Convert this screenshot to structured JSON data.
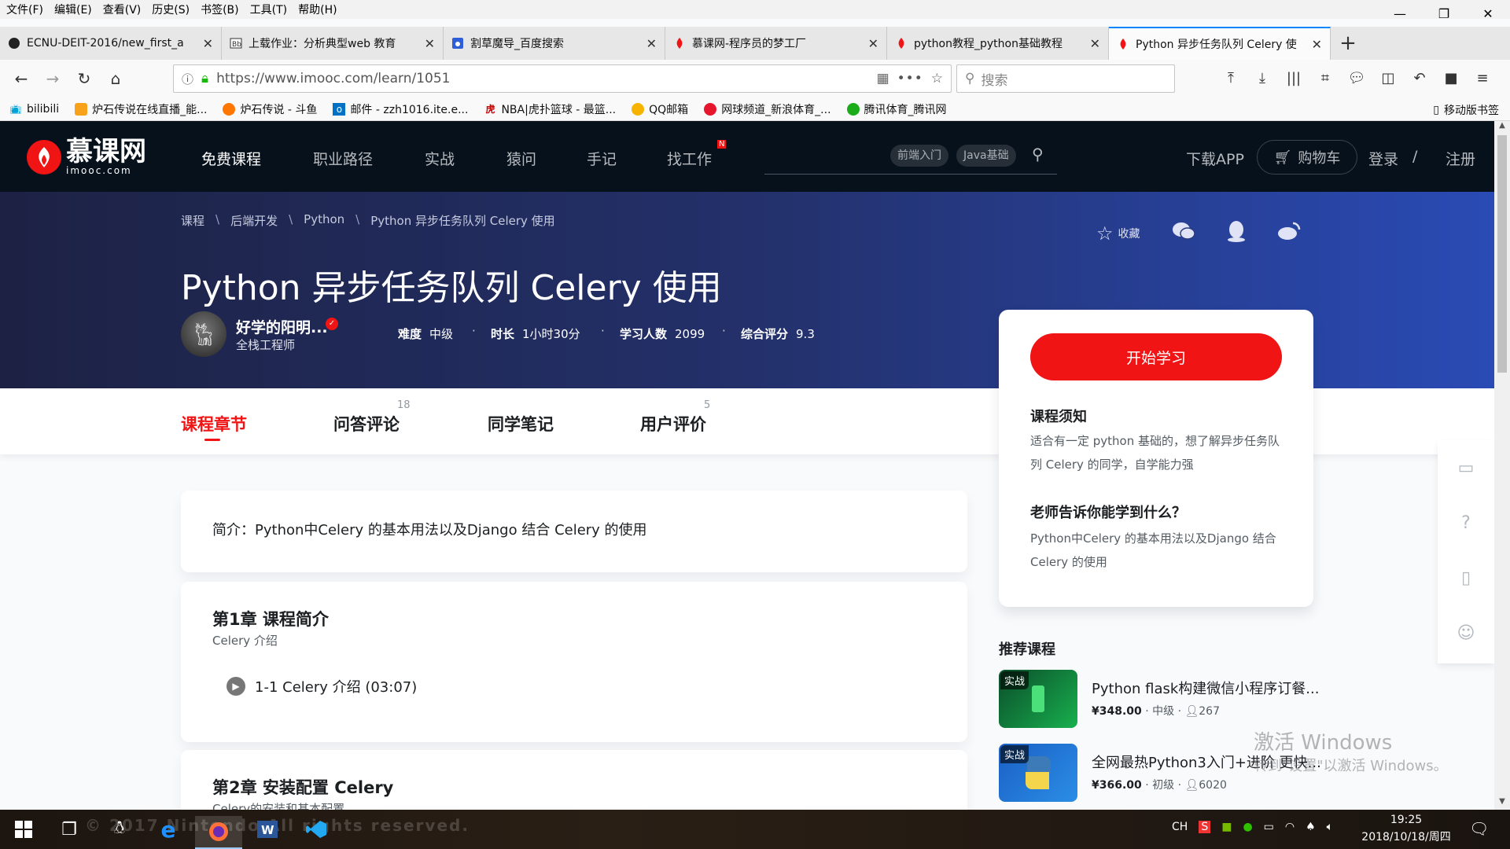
{
  "menubar": [
    "文件(F)",
    "编辑(E)",
    "查看(V)",
    "历史(S)",
    "书签(B)",
    "工具(T)",
    "帮助(H)"
  ],
  "window_controls": {
    "minimize": "—",
    "restore": "❐",
    "close": "✕"
  },
  "tabs": [
    {
      "title": "ECNU-DEIT-2016/new_first_a",
      "icon": "github-icon"
    },
    {
      "title": "上载作业：分析典型web 教育",
      "icon": "blackboard-icon"
    },
    {
      "title": "割草魔导_百度搜索",
      "icon": "baidu-icon"
    },
    {
      "title": "慕课网-程序员的梦工厂",
      "icon": "imooc-icon"
    },
    {
      "title": "python教程_python基础教程",
      "icon": "imooc-icon"
    },
    {
      "title": "Python 异步任务队列 Celery 使",
      "icon": "imooc-icon"
    }
  ],
  "nav": {
    "url": "https://www.imooc.com/learn/1051",
    "search_placeholder": "搜索"
  },
  "bookmarks": [
    {
      "label": "bilibili",
      "icon": "bilibili-icon"
    },
    {
      "label": "炉石传说在线直播_能...",
      "icon": "huya-icon"
    },
    {
      "label": "炉石传说 - 斗鱼",
      "icon": "douyu-icon"
    },
    {
      "label": "邮件 - zzh1016.ite.e...",
      "icon": "outlook-icon"
    },
    {
      "label": "NBA|虎扑篮球 - 最篮...",
      "icon": "hupu-icon"
    },
    {
      "label": "QQ邮箱",
      "icon": "qq-icon"
    },
    {
      "label": "网球频道_新浪体育_...",
      "icon": "weibo-icon"
    },
    {
      "label": "腾讯体育_腾讯网",
      "icon": "tencent-icon"
    }
  ],
  "mobile_bookmarks": "移动版书签",
  "site": {
    "logo_cn": "慕课网",
    "logo_en": "imooc.com",
    "nav": [
      "免费课程",
      "职业路径",
      "实战",
      "猿问",
      "手记",
      "找工作"
    ],
    "new_badge": "N",
    "search_tags": [
      "前端入门",
      "Java基础"
    ],
    "download_app": "下载APP",
    "cart": "购物车",
    "login": "登录",
    "slash": "/",
    "register": "注册"
  },
  "banner": {
    "breadcrumb": [
      "课程",
      "后端开发",
      "Python",
      "Python 异步任务队列 Celery 使用"
    ],
    "breadcrumb_sep": "\\",
    "title": "Python 异步任务队列 Celery 使用",
    "teacher_name": "好学的阳明...",
    "teacher_role": "全栈工程师",
    "stats": [
      {
        "label": "难度",
        "value": "中级"
      },
      {
        "label": "时长",
        "value": "1小时30分"
      },
      {
        "label": "学习人数",
        "value": "2099"
      },
      {
        "label": "综合评分",
        "value": "9.3"
      }
    ],
    "favorite_label": "收藏"
  },
  "course_tabs": [
    {
      "label": "课程章节",
      "count": ""
    },
    {
      "label": "问答评论",
      "count": "18"
    },
    {
      "label": "同学笔记",
      "count": ""
    },
    {
      "label": "用户评价",
      "count": "5"
    }
  ],
  "intro": "简介：Python中Celery 的基本用法以及Django 结合 Celery 的使用",
  "chapters": [
    {
      "title": "第1章 课程简介",
      "subtitle": "Celery 介绍",
      "lessons": [
        "1-1 Celery 介绍 (03:07)"
      ]
    },
    {
      "title": "第2章 安装配置 Celery",
      "subtitle": "Celery的安装和基本配置",
      "lessons": []
    }
  ],
  "side_card": {
    "start_button": "开始学习",
    "notice_title": "课程须知",
    "notice_text": "适合有一定 python 基础的，想了解异步任务队列 Celery 的同学，自学能力强",
    "learn_title": "老师告诉你能学到什么？",
    "learn_text": "Python中Celery 的基本用法以及Django 结合 Celery 的使用"
  },
  "recommend": {
    "title": "推荐课程",
    "items": [
      {
        "tag": "实战",
        "title": "Python flask构建微信小程序订餐...",
        "price": "¥348.00",
        "level": "中级",
        "students": "267"
      },
      {
        "tag": "实战",
        "title": "全网最热Python3入门+进阶 更快...",
        "price": "¥366.00",
        "level": "初级",
        "students": "6020"
      }
    ]
  },
  "watermark": {
    "line1": "激活 Windows",
    "line2": "转到\"设置\"以激活 Windows。"
  },
  "taskbar": {
    "copyright": "© 2017 Nintendo All rights reserved.",
    "ime": "CH",
    "time": "19:25",
    "date": "2018/10/18/周四"
  },
  "colors": {
    "brand_red": "#f01414",
    "header_bg": "#07111b",
    "banner_start": "#1d2244",
    "banner_end": "#2a4bb5"
  }
}
